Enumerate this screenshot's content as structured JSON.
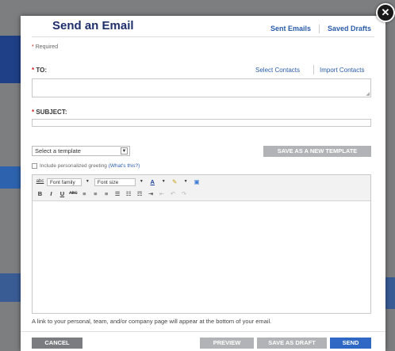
{
  "modal": {
    "title": "Send an Email",
    "close_glyph": "✕",
    "links": {
      "sent_emails": "Sent Emails",
      "saved_drafts": "Saved Drafts"
    },
    "required_star": "*",
    "required_text": "Required",
    "to_label": "TO:",
    "select_contacts": "Select Contacts",
    "import_contacts": "Import Contacts",
    "subject_label": "SUBJECT:",
    "template_select": "Select a template",
    "save_template": "SAVE AS A NEW TEMPLATE",
    "greeting_text": "Include personalized greeting",
    "whats_this": "(What's this?)",
    "toolbar": {
      "font_family": "Font family",
      "font_size": "Font size",
      "bold": "B",
      "italic": "I",
      "underline": "U",
      "strike": "ABC"
    },
    "footer_note": "A link to your personal, team, and/or company page will appear at the bottom of your email.",
    "cancel": "CANCEL",
    "preview": "PREVIEW",
    "save_draft": "SAVE AS DRAFT",
    "send": "SEND"
  },
  "colors": {
    "title": "#1f2f6b",
    "link": "#2a5caa",
    "send": "#2f67c4",
    "disabled": "#b1b3b6",
    "cancel": "#7a7c80"
  }
}
